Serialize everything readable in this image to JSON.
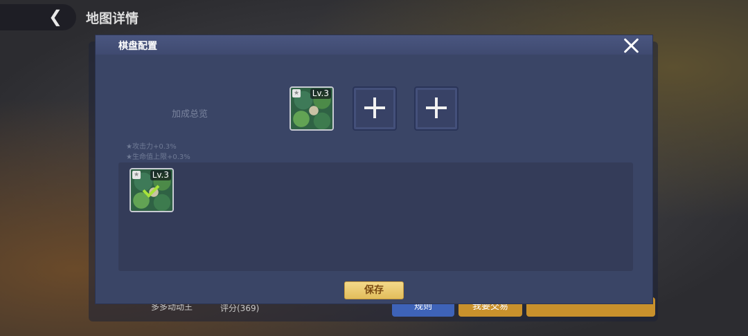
{
  "background": {
    "page_title": "地图详情",
    "footer_name": "多多动动王",
    "footer_score": "评分(369)",
    "rules_button": "规则",
    "trade_button": "我要交易"
  },
  "dialog": {
    "title": "棋盘配置",
    "summary_title": "加成总览",
    "stats": [
      "★攻击力+0.3%",
      "★生命值上限+0.3%"
    ],
    "slots": [
      {
        "filled": true,
        "level": "Lv.3"
      },
      {
        "filled": false
      },
      {
        "filled": false
      }
    ],
    "inventory": [
      {
        "level": "Lv.3",
        "selected": true
      }
    ],
    "save_label": "保存"
  },
  "colors": {
    "dialog_bg": "#3a4566",
    "header_bg": "#4a5680",
    "save_button": "#f3d98a",
    "check": "#a8e23a"
  }
}
